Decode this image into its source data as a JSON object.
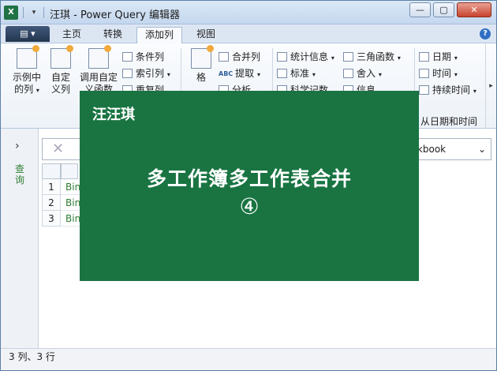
{
  "titlebar": {
    "app_icon": "X",
    "quick_access_dropdown": "▾",
    "title": "汪琪 - Power Query 编辑器",
    "minimize": "—",
    "maximize": "▢",
    "close": "✕"
  },
  "tabs": {
    "file": "▤ ▾",
    "items": [
      "主页",
      "转换",
      "添加列",
      "视图"
    ],
    "active": "添加列",
    "help": "?"
  },
  "ribbon": {
    "example_col": {
      "line1": "示例中",
      "line2": "的列",
      "dropdown": "▾"
    },
    "custom_col": {
      "line1": "自定",
      "line2": "义列"
    },
    "invoke_custom": {
      "line1": "调用自定",
      "line2": "义函数"
    },
    "conditional_col": "条件列",
    "index_col": "索引列",
    "index_dropdown": "▾",
    "duplicate_col": "重复列",
    "format": "格",
    "abc_icon": "ABC",
    "abc123_icon": "ABC\n123",
    "merge_cols": "合并列",
    "extract": "提取",
    "parse": "分析",
    "statistics": "统计信息",
    "standard": "标准",
    "scientific": "科学记数",
    "trigonometry": "三角函数",
    "rounding": "舍入",
    "information": "信息",
    "date": "日期",
    "time": "时间",
    "duration": "持续时间",
    "dropdown": "▾",
    "group_datetime": "从日期和时间",
    "scroll": "▸"
  },
  "navigator": {
    "chevron": "›",
    "label": "查询"
  },
  "formula_bar": {
    "cancel": "✕",
    "source_value": "rkbook",
    "source_chevron": "⌄"
  },
  "grid": {
    "rows": [
      {
        "num": "1",
        "value": "Bin"
      },
      {
        "num": "2",
        "value": "Bin"
      },
      {
        "num": "3",
        "value": "Bin"
      }
    ]
  },
  "status": "3 列、3 行",
  "overlay": {
    "author": "汪汪琪",
    "title": "多工作簿多工作表合并",
    "number": "④"
  },
  "colors": {
    "overlay_green": "#197442",
    "accent_blue": "#2e6fc2",
    "title_bar": "#c4d7ee"
  }
}
